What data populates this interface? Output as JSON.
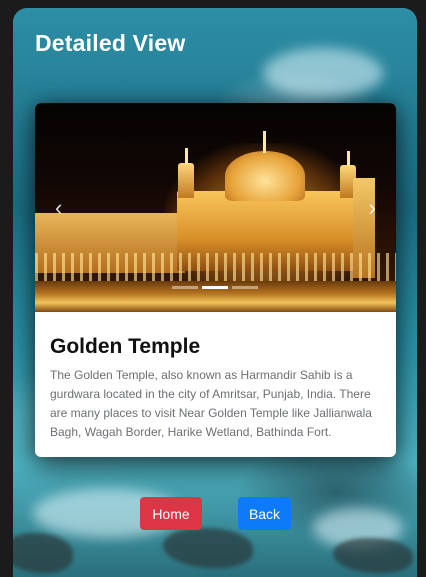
{
  "page": {
    "title": "Detailed View"
  },
  "carousel": {
    "prev_icon": "chevron-left-icon",
    "next_icon": "chevron-right-icon",
    "prev_glyph": "‹",
    "next_glyph": "›",
    "slide_count": 3,
    "active_slide": 2
  },
  "place": {
    "name": "Golden Temple",
    "description": "The Golden Temple, also known as Harmandir Sahib is a gurdwara located in the city of Amritsar, Punjab, India. There are many places to visit Near Golden Temple like Jallianwala Bagh, Wagah Border, Harike Wetland, Bathinda Fort."
  },
  "actions": {
    "home_label": "Home",
    "back_label": "Back"
  },
  "colors": {
    "home_button": "#dc3545",
    "back_button": "#0d7bf7",
    "title_text": "#ffffff"
  }
}
